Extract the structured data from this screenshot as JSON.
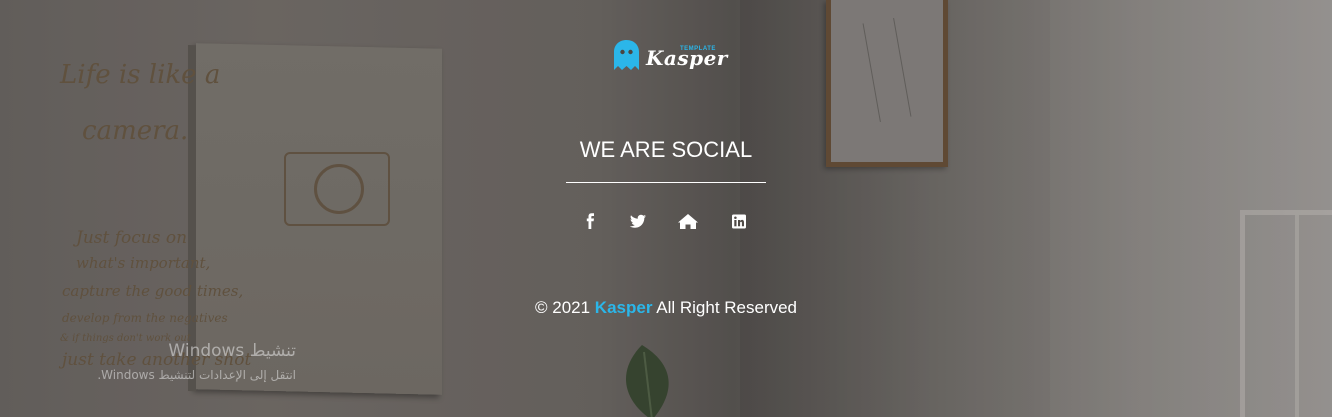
{
  "colors": {
    "accent": "#2bb6e9",
    "text": "#ffffff"
  },
  "logo": {
    "name": "Kasper",
    "tag": "TEMPLATE"
  },
  "social": {
    "title": "WE ARE SOCIAL",
    "links": [
      {
        "icon": "facebook-icon"
      },
      {
        "icon": "twitter-icon"
      },
      {
        "icon": "home-icon"
      },
      {
        "icon": "linkedin-icon"
      }
    ]
  },
  "copyright": {
    "prefix": "© 2021",
    "brand": "Kasper",
    "suffix": "All Right Reserved"
  },
  "background": {
    "poster_lines": [
      "Life is like a",
      "camera.",
      "Just focus on",
      "what's important,",
      "capture the good times,",
      "develop from the negatives",
      "& if things don't work out",
      "just take another shot"
    ]
  },
  "watermark": {
    "title": "تنشيط Windows",
    "subtitle": "انتقل إلى الإعدادات لتنشيط Windows."
  }
}
